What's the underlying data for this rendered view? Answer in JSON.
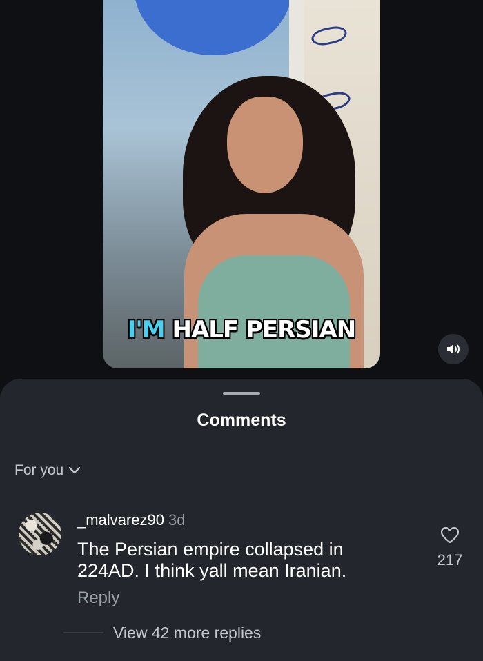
{
  "video": {
    "caption_accent": "I'M",
    "caption_rest": " HALF PERSIAN",
    "caption_accent_color": "#4ad0ee"
  },
  "controls": {
    "mute_icon": "speaker-icon"
  },
  "comments": {
    "title": "Comments",
    "filter_label": "For you",
    "items": [
      {
        "username": "_malvarez90",
        "time": "3d",
        "text": "The Persian empire collapsed in 224AD. I think yall mean Iranian.",
        "reply_label": "Reply",
        "likes": "217",
        "view_replies": "View 42 more replies"
      }
    ]
  }
}
